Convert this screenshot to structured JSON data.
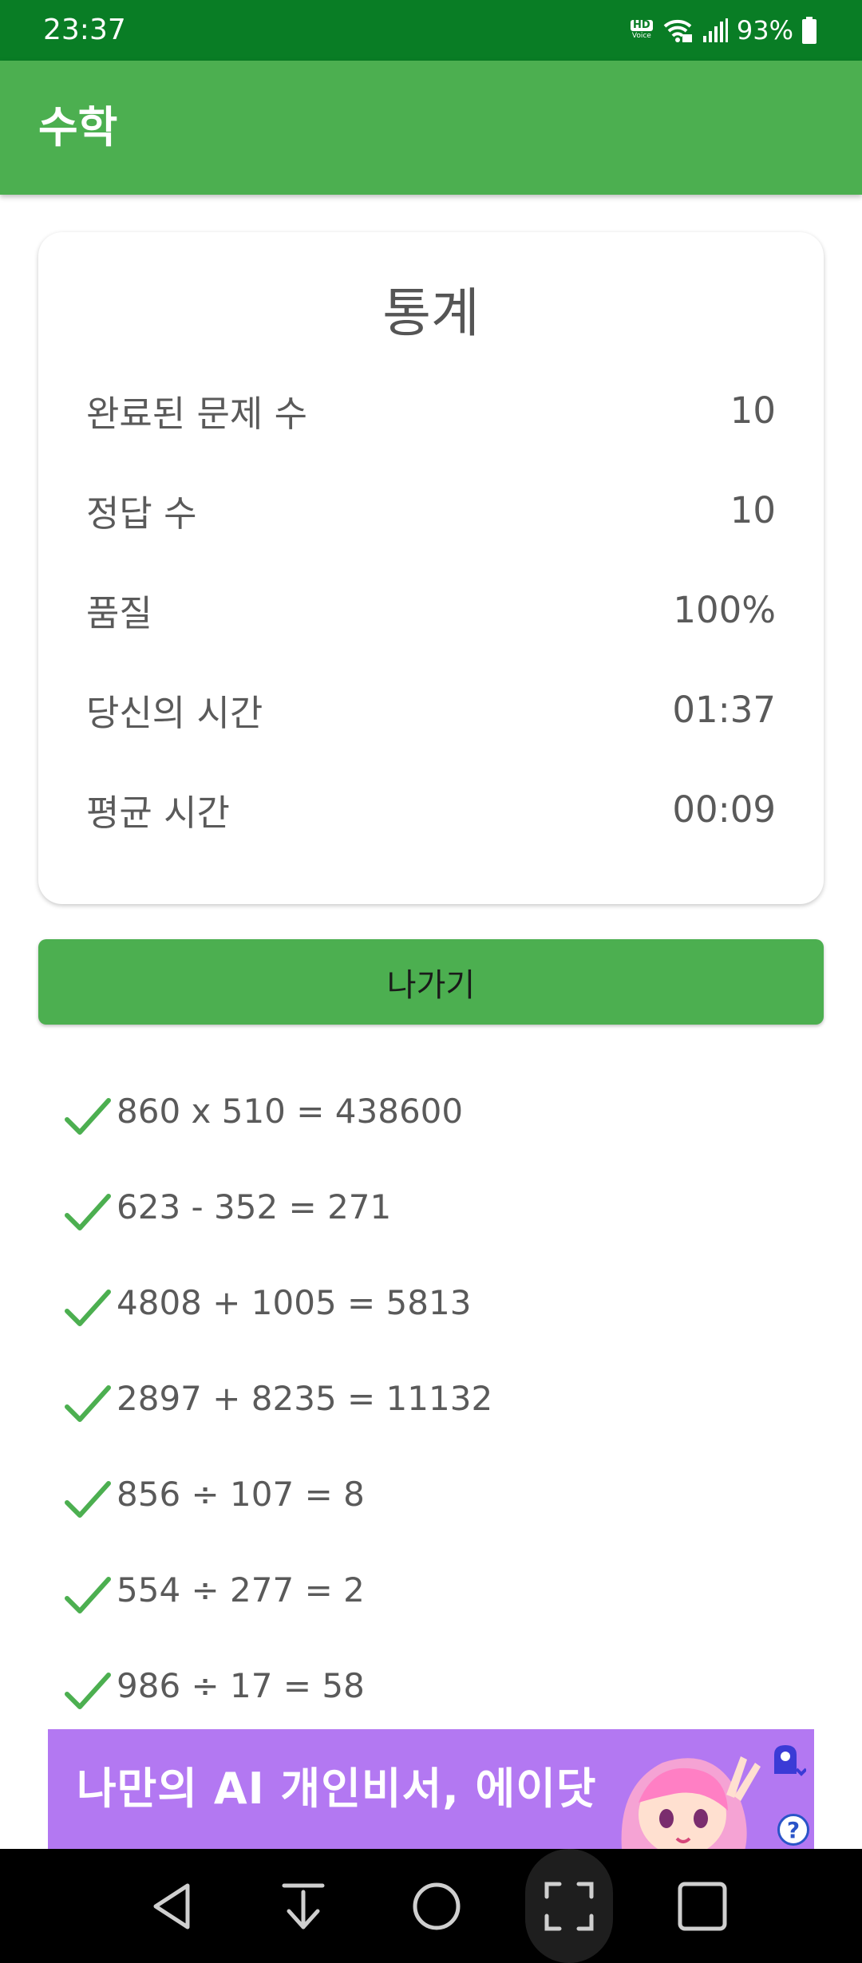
{
  "status_bar": {
    "time": "23:37",
    "hd_label": "HD",
    "voice_label": "Voice",
    "battery": "93%",
    "icons": [
      "hd-voice-icon",
      "wifi-icon",
      "signal-icon",
      "battery-icon"
    ]
  },
  "app_bar": {
    "title": "수학"
  },
  "stats": {
    "title": "통계",
    "rows": [
      {
        "label": "완료된 문제 수",
        "value": "10"
      },
      {
        "label": "정답 수",
        "value": "10"
      },
      {
        "label": "품질",
        "value": "100%"
      },
      {
        "label": "당신의 시간",
        "value": "01:37"
      },
      {
        "label": "평균 시간",
        "value": "00:09"
      }
    ]
  },
  "exit_button": {
    "label": "나가기"
  },
  "results": [
    {
      "text": "860 x 510 = 438600",
      "correct": true
    },
    {
      "text": "623 - 352 = 271",
      "correct": true
    },
    {
      "text": "4808 + 1005 = 5813",
      "correct": true
    },
    {
      "text": "2897 + 8235 = 11132",
      "correct": true
    },
    {
      "text": "856 ÷ 107 = 8",
      "correct": true
    },
    {
      "text": "554 ÷ 277 = 2",
      "correct": true
    },
    {
      "text": "986 ÷ 17 = 58",
      "correct": true
    }
  ],
  "ad": {
    "text": "나만의 AI 개인비서, 에이닷",
    "help_label": "?"
  },
  "colors": {
    "status_bar": "#097d25",
    "app_bar": "#4caf50",
    "check": "#4caf50",
    "ad_background": "#b378f2"
  },
  "nav_bar": {
    "icons": [
      "back-icon",
      "download-icon",
      "home-icon",
      "screenshot-icon",
      "recents-icon"
    ]
  }
}
